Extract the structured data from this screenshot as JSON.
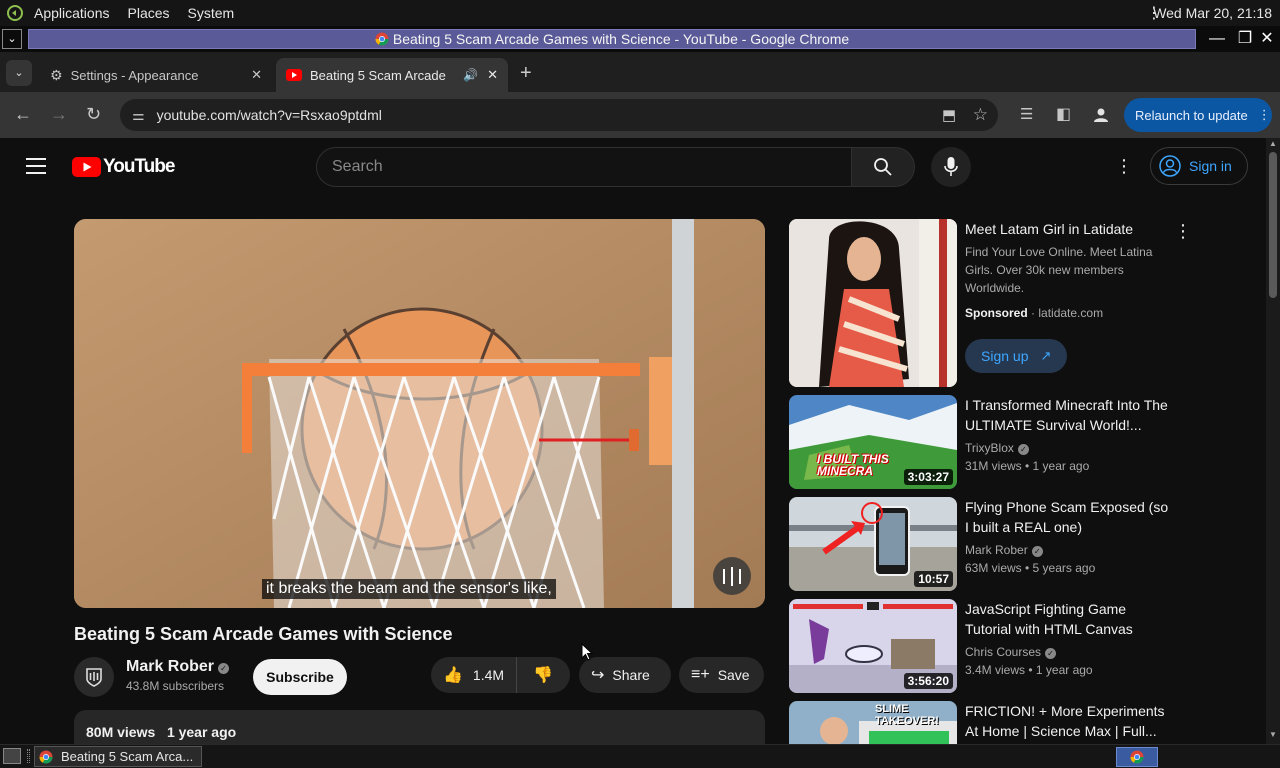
{
  "system_panel": {
    "menus": [
      "Applications",
      "Places",
      "System"
    ],
    "clock": "Wed Mar 20, 21:18"
  },
  "window": {
    "title": "Beating 5 Scam Arcade Games with Science - YouTube - Google Chrome"
  },
  "tabs": [
    {
      "label": "Settings - Appearance",
      "icon": "gear-icon"
    },
    {
      "label": "Beating 5 Scam Arcade G",
      "icon": "youtube-icon",
      "audio": true
    }
  ],
  "toolbar": {
    "url": "youtube.com/watch?v=Rsxao9ptdml",
    "relaunch_label": "Relaunch to update"
  },
  "youtube": {
    "logo_text": "YouTube",
    "search_placeholder": "Search",
    "signin_label": "Sign in",
    "caption": "it breaks the beam and the sensor's like,",
    "video_title": "Beating 5 Scam Arcade Games with Science",
    "channel_name": "Mark Rober",
    "subscribers": "43.8M subscribers",
    "subscribe_label": "Subscribe",
    "likes": "1.4M",
    "share_label": "Share",
    "save_label": "Save",
    "views": "80M views",
    "age": "1 year ago",
    "ad": {
      "title": "Meet Latam Girl in Latidate",
      "description": "Find Your Love Online. Meet Latina Girls. Over 30k new members Worldwide.",
      "sponsored": "Sponsored",
      "domain": "latidate.com",
      "cta": "Sign up"
    },
    "recommendations": [
      {
        "title": "I Transformed Minecraft Into The ULTIMATE Survival World!...",
        "channel": "TrixyBlox",
        "meta": "31M views • 1 year ago",
        "duration": "3:03:27",
        "thumb_text": "I BUILT THIS MINECRA"
      },
      {
        "title": "Flying Phone Scam Exposed (so I built a REAL one)",
        "channel": "Mark Rober",
        "meta": "63M views • 5 years ago",
        "duration": "10:57"
      },
      {
        "title": "JavaScript Fighting Game Tutorial with HTML Canvas",
        "channel": "Chris Courses",
        "meta": "3.4M views • 1 year ago",
        "duration": "3:56:20"
      },
      {
        "title": "FRICTION! + More Experiments At Home | Science Max | Full...",
        "channel": "",
        "meta": "",
        "duration": "",
        "thumb_text": "SLIME TAKEOVER!"
      }
    ]
  },
  "taskbar": {
    "task_label": "Beating 5 Scam Arca..."
  }
}
